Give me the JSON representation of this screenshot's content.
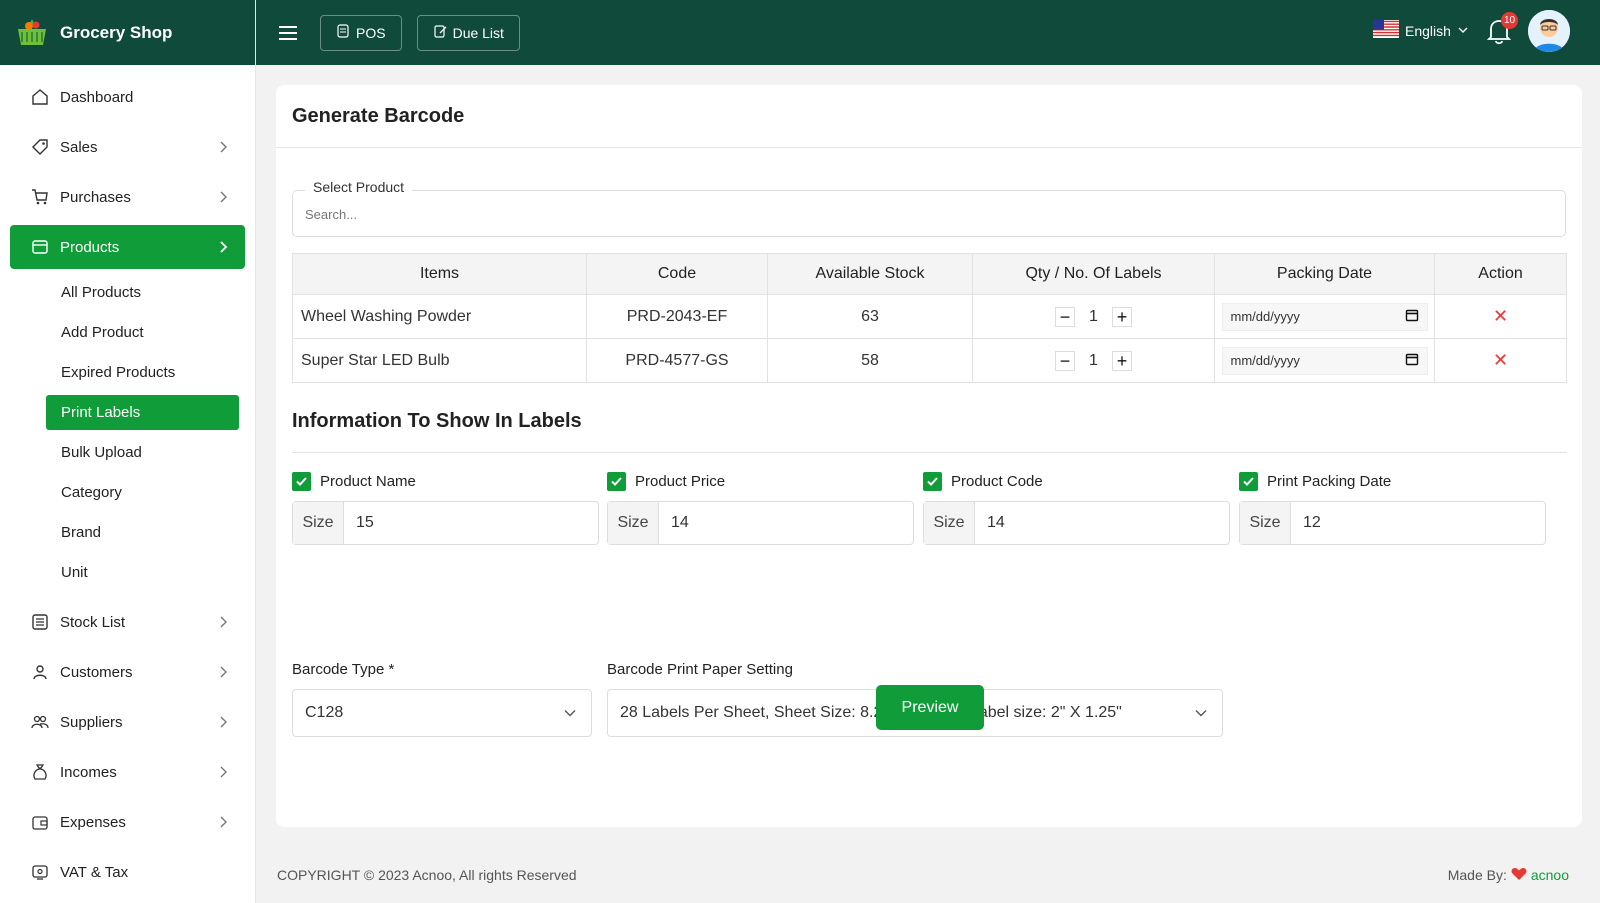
{
  "brand": {
    "name": "Grocery Shop"
  },
  "header": {
    "pos_label": "POS",
    "due_list_label": "Due List",
    "language": "English",
    "notification_count": "10"
  },
  "sidebar": {
    "items": [
      {
        "label": "Dashboard",
        "icon": "home-icon",
        "has_chevron": false
      },
      {
        "label": "Sales",
        "icon": "tag-icon",
        "has_chevron": true
      },
      {
        "label": "Purchases",
        "icon": "cart-icon",
        "has_chevron": true
      },
      {
        "label": "Products",
        "icon": "box-icon",
        "has_chevron": true,
        "active": true
      },
      {
        "label": "Stock List",
        "icon": "list-icon",
        "has_chevron": true
      },
      {
        "label": "Customers",
        "icon": "users-icon",
        "has_chevron": true
      },
      {
        "label": "Suppliers",
        "icon": "supplier-icon",
        "has_chevron": true
      },
      {
        "label": "Incomes",
        "icon": "money-bag-icon",
        "has_chevron": true
      },
      {
        "label": "Expenses",
        "icon": "wallet-icon",
        "has_chevron": true
      },
      {
        "label": "VAT & Tax",
        "icon": "receipt-icon",
        "has_chevron": false
      }
    ],
    "products_sub": [
      "All Products",
      "Add Product",
      "Expired Products",
      "Print Labels",
      "Bulk Upload",
      "Category",
      "Brand",
      "Unit"
    ],
    "active_sub": "Print Labels"
  },
  "page": {
    "title": "Generate Barcode",
    "select_product_label": "Select Product",
    "search_placeholder": "Search..."
  },
  "table": {
    "headers": [
      "Items",
      "Code",
      "Available Stock",
      "Qty / No. Of Labels",
      "Packing Date",
      "Action"
    ],
    "rows": [
      {
        "item": "Wheel Washing Powder",
        "code": "PRD-2043-EF",
        "stock": "63",
        "qty": "1",
        "date": "mm/dd/yyyy"
      },
      {
        "item": "Super Star LED Bulb",
        "code": "PRD-4577-GS",
        "stock": "58",
        "qty": "1",
        "date": "mm/dd/yyyy"
      }
    ]
  },
  "info": {
    "title": "Information To Show In Labels",
    "options": [
      {
        "label": "Product Name",
        "size_label": "Size",
        "size": "15",
        "checked": true
      },
      {
        "label": "Product Price",
        "size_label": "Size",
        "size": "14",
        "checked": true
      },
      {
        "label": "Product Code",
        "size_label": "Size",
        "size": "14",
        "checked": true
      },
      {
        "label": "Print Packing Date",
        "size_label": "Size",
        "size": "12",
        "checked": true
      }
    ],
    "barcode_type_label": "Barcode Type *",
    "barcode_type_value": "C128",
    "paper_setting_label": "Barcode Print Paper Setting",
    "paper_setting_value": "28 Labels Per Sheet, Sheet Size: 8.27\" X 11.69\", Label size: 2\" X 1.25\"",
    "preview_label": "Preview"
  },
  "footer": {
    "copyright": "COPYRIGHT © 2023 Acnoo, All rights Reserved",
    "made_by_label": "Made By:",
    "made_by_brand": "acnoo"
  },
  "colors": {
    "primary": "#119c3a",
    "header": "#0f4a3a",
    "danger": "#e53935"
  }
}
